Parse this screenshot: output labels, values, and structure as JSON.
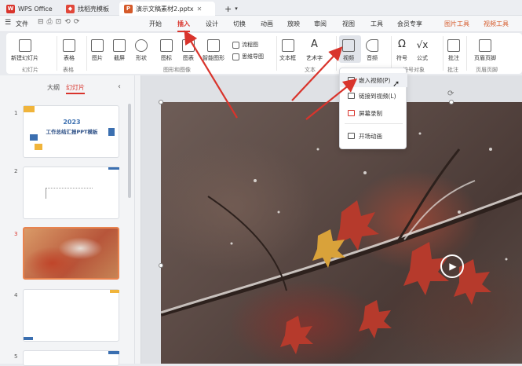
{
  "tabs": {
    "wps_label": "WPS Office",
    "tab1_label": "找稻壳模板",
    "tab2_label": "演示文稿素材2.pptx",
    "add_label": "+"
  },
  "menu": {
    "file": "文件",
    "items": [
      "开始",
      "插入",
      "设计",
      "切换",
      "动画",
      "放映",
      "审阅",
      "视图",
      "工具",
      "会员专享",
      "图片工具",
      "视频工具"
    ],
    "active_index": 1
  },
  "ribbon": {
    "new_slide": "新建幻灯片",
    "table": "表格",
    "picture": "图片",
    "screenshot": "截屏",
    "shape": "形状",
    "icon": "图标",
    "chart": "图表",
    "smartart": "智能图形",
    "flowchart": "流程图",
    "mindmap": "思维导图",
    "textbox": "文本框",
    "wordart": "艺术字",
    "video": "视频",
    "audio": "音频",
    "symbol": "符号",
    "formula": "公式",
    "comment": "批注",
    "header_footer": "页眉页脚",
    "groups": {
      "slides": "幻灯片",
      "table": "表格",
      "media_img": "图形和图像",
      "text": "文本",
      "symbol": "符号对象",
      "comment": "批注",
      "header": "页眉页脚"
    }
  },
  "panel": {
    "outline_tab": "大纲",
    "slides_tab": "幻灯片",
    "slide1_year": "2023",
    "slide1_title": "工作总结汇报PPT模板",
    "numbers": [
      "1",
      "2",
      "3",
      "4",
      "5"
    ]
  },
  "dropdown": {
    "items": [
      "嵌入视频(P)",
      "链接到视频(L)",
      "屏幕录制",
      "开场动画"
    ]
  },
  "colors": {
    "accent": "#d9342c",
    "arrow": "#d9342c"
  }
}
